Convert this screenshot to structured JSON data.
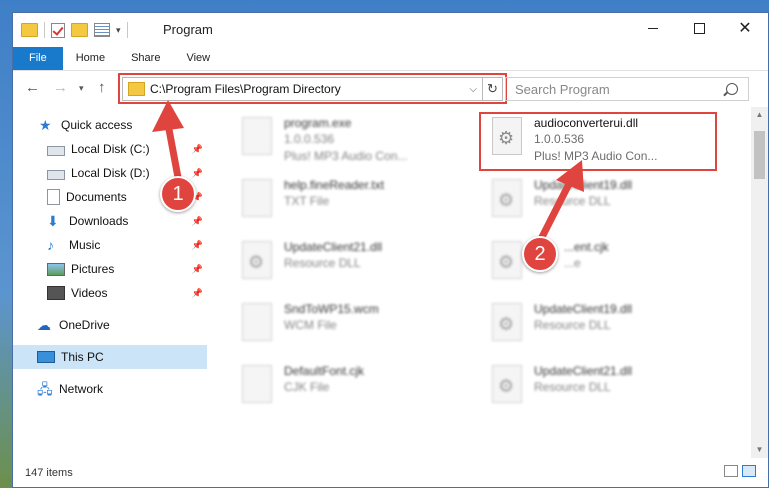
{
  "window": {
    "title": "Program"
  },
  "ribbon": {
    "tabs": [
      "File",
      "Home",
      "Share",
      "View"
    ]
  },
  "address": {
    "path": "C:\\Program Files\\Program Directory"
  },
  "search": {
    "placeholder": "Search Program"
  },
  "sidebar": {
    "items": [
      {
        "label": "Quick access",
        "icon": "star-icon",
        "pinned": false
      },
      {
        "label": "Local Disk (C:)",
        "icon": "disk-icon",
        "pinned": true
      },
      {
        "label": "Local Disk (D:)",
        "icon": "disk-icon",
        "pinned": true
      },
      {
        "label": "Documents",
        "icon": "documents-icon",
        "pinned": true
      },
      {
        "label": "Downloads",
        "icon": "download-icon",
        "pinned": true
      },
      {
        "label": "Music",
        "icon": "music-icon",
        "pinned": true
      },
      {
        "label": "Pictures",
        "icon": "pictures-icon",
        "pinned": true
      },
      {
        "label": "Videos",
        "icon": "videos-icon",
        "pinned": true
      },
      {
        "label": "OneDrive",
        "icon": "cloud-icon",
        "pinned": false
      },
      {
        "label": "This PC",
        "icon": "pc-icon",
        "pinned": false,
        "selected": true
      },
      {
        "label": "Network",
        "icon": "network-icon",
        "pinned": false
      }
    ]
  },
  "files": [
    {
      "name": "program.exe",
      "line2": "1.0.0.536",
      "line3": "Plus! MP3 Audio Con...",
      "blurred": true
    },
    {
      "name": "audioconverterui.dll",
      "line2": "1.0.0.536",
      "line3": "Plus! MP3 Audio Con...",
      "blurred": false,
      "highlighted": true
    },
    {
      "name": "help.fineReader.txt",
      "line2": "TXT File",
      "blurred": true
    },
    {
      "name": "UpdateClient19.dll",
      "line2": "Resource DLL",
      "blurred": true
    },
    {
      "name": "UpdateClient21.dll",
      "line2": "Resource DLL",
      "blurred": true
    },
    {
      "name": "...ent.cjk",
      "line2": "...e",
      "blurred": true
    },
    {
      "name": "SndToWP15.wcm",
      "line2": "WCM File",
      "blurred": true
    },
    {
      "name": "UpdateClient19.dll",
      "line2": "Resource DLL",
      "blurred": true
    },
    {
      "name": "DefaultFont.cjk",
      "line2": "CJK File",
      "blurred": true
    },
    {
      "name": "UpdateClient21.dll",
      "line2": "Resource DLL",
      "blurred": true
    }
  ],
  "status": {
    "count": "147 items"
  },
  "annotations": {
    "badge1": "1",
    "badge2": "2",
    "color": "#e0443f"
  }
}
